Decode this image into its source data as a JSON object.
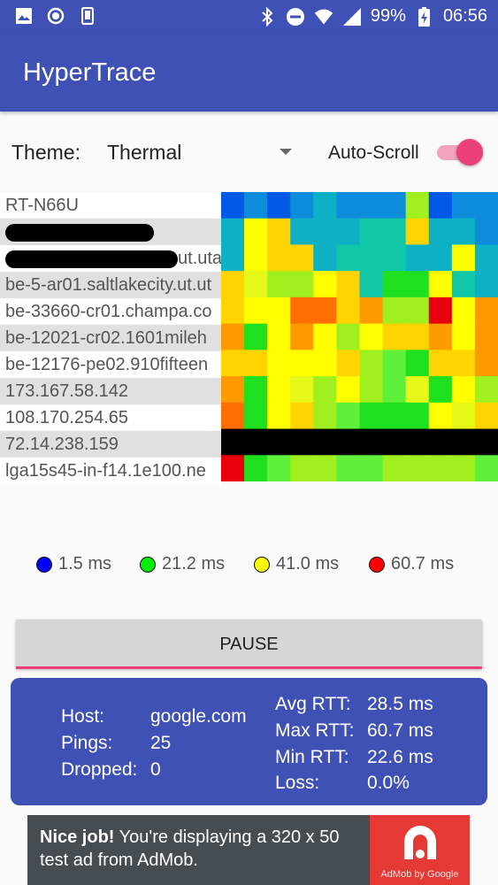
{
  "status_bar": {
    "battery_percent": "99%",
    "time": "06:56",
    "left_icons": [
      "image-icon",
      "record-icon",
      "phone-icon"
    ],
    "right_icons": [
      "bluetooth-icon",
      "do-not-disturb-icon",
      "wifi-icon",
      "signal-icon",
      "battery-charging-icon"
    ]
  },
  "app_bar": {
    "title": "HyperTrace",
    "color": "#3F51B5"
  },
  "controls": {
    "theme_label": "Theme:",
    "theme_value": "Thermal",
    "autoscroll_label": "Auto-Scroll",
    "autoscroll_on": true,
    "accent_color": "#EC407A"
  },
  "hops": [
    {
      "text": "RT-N66U",
      "redacted": false
    },
    {
      "text": "",
      "redacted": true
    },
    {
      "text": "ut.uta",
      "redacted": true
    },
    {
      "text": "be-5-ar01.saltlakecity.ut.ut",
      "redacted": false
    },
    {
      "text": "be-33660-cr01.champa.co",
      "redacted": false
    },
    {
      "text": "be-12021-cr02.1601mileh",
      "redacted": false
    },
    {
      "text": "be-12176-pe02.910fifteen",
      "redacted": false
    },
    {
      "text": "173.167.58.142",
      "redacted": false
    },
    {
      "text": "108.170.254.65",
      "redacted": false
    },
    {
      "text": "72.14.238.159",
      "redacted": false
    },
    {
      "text": "lga15s45-in-f14.1e100.ne",
      "redacted": false
    }
  ],
  "heatmap": {
    "palette": {
      "B": "#0058e6",
      "b": "#0e8cdc",
      "c": "#0eb0c4",
      "t": "#10c8a8",
      "G": "#1ee01e",
      "g": "#5ef03a",
      "l": "#a0f020",
      "y": "#e6f818",
      "Y": "#ffff00",
      "a": "#ffd400",
      "o": "#ff9a00",
      "O": "#ff6e00",
      "R": "#e8000c",
      "K": "#000000"
    },
    "rows": [
      "BbBbcbbblBbb",
      "cYacccttaccb",
      "cYaactttccYc",
      "ayllYatGGYtc",
      "aYYOOaollRYo",
      "oGYoYlYaaoYo",
      "aaYYYalgGaao",
      "oGYylYlgyGYl",
      "OGYalgGGGYya",
      "KKKKKKKKKKKK",
      "RGgllggllllg"
    ]
  },
  "legend": [
    {
      "label": "1.5 ms",
      "color": "#0000ff"
    },
    {
      "label": "21.2 ms",
      "color": "#00ee00"
    },
    {
      "label": "41.0 ms",
      "color": "#ffff00"
    },
    {
      "label": "60.7 ms",
      "color": "#ff0000"
    }
  ],
  "pause_button": {
    "label": "PAUSE"
  },
  "stats": {
    "host_label": "Host:",
    "host_value": "google.com",
    "pings_label": "Pings:",
    "pings_value": "25",
    "dropped_label": "Dropped:",
    "dropped_value": "0",
    "avg_label": "Avg RTT:",
    "avg_value": "28.5 ms",
    "max_label": "Max RTT:",
    "max_value": "60.7 ms",
    "min_label": "Min RTT:",
    "min_value": "22.6 ms",
    "loss_label": "Loss:",
    "loss_value": "0.0%"
  },
  "ad": {
    "headline": "Nice job!",
    "body": "You're displaying a 320 x 50 test ad from AdMob.",
    "logo_caption": "AdMob by Google"
  }
}
